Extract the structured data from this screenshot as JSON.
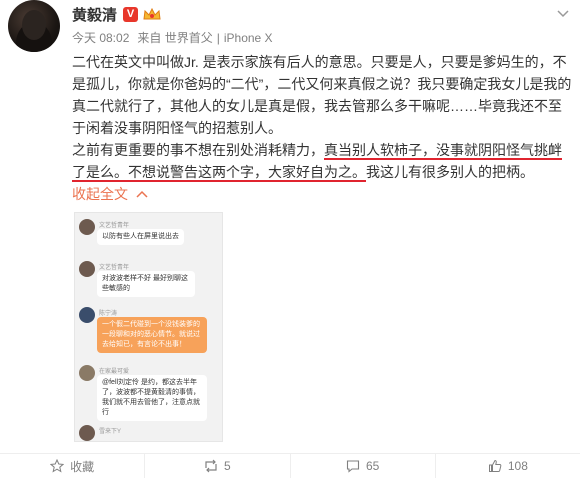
{
  "user": {
    "name": "黄毅清",
    "v_badge": "V"
  },
  "meta": {
    "time": "今天 08:02",
    "from": "来自 世界首父",
    "device": "iPhone X"
  },
  "post": {
    "p1": "二代在英文中叫做Jr. 是表示家族有后人的意思。只要是人，只要是爹妈生的，不是孤儿，你就是你爸妈的“二代”，二代又何来真假之说？我只要确定我女儿是我的真二代就行了，其他人的女儿是真是假，我去管那么多干嘛呢……毕竟我还不至于闲着没事阴阳怪气的招惹别人。",
    "p2_a": "之前有更重要的事不想在别处消耗精力，",
    "p2_u1": "真当别人软柿子，没事就阴阳怪气挑衅了是么。不想说警告这两个字，大家好自为之。",
    "p2_b": "我这儿有很多别人的把柄。",
    "expand": "收起全文",
    "expand_icon": "chevron-up-icon"
  },
  "chat": [
    {
      "name": "文艺哲青年",
      "text": "以防有些人在屏里说出去"
    },
    {
      "name": "文艺哲青年",
      "text": "对波波老样不好 最好别聊这些敏感的"
    },
    {
      "name": "陈宁涛",
      "text": "一个假二代碰到一个没钱装爹的一段聊和对的恶心情节。就说过去给知已，有言论不出事！"
    },
    {
      "name": "在家最可爱",
      "text": "@fell刘定伶 是约，都这去半年了，波波都不提黄毅清的事情，我们就不用去管他了，注意点就行"
    },
    {
      "name": "雪来下Y",
      "text": ""
    }
  ],
  "footer": {
    "favorite": "收藏",
    "repost": "5",
    "comment": "65",
    "like": "108"
  }
}
